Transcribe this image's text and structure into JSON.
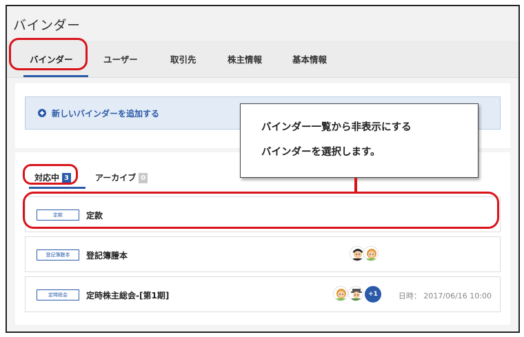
{
  "page": {
    "title": "バインダー"
  },
  "tabs": [
    {
      "label": "バインダー",
      "active": true
    },
    {
      "label": "ユーザー"
    },
    {
      "label": "取引先"
    },
    {
      "label": "株主情報"
    },
    {
      "label": "基本情報"
    }
  ],
  "add_binder": {
    "label": "新しいバインダーを追加する",
    "icon": "plus-circle-icon"
  },
  "subtabs": [
    {
      "label": "対応中",
      "count": "3",
      "active": true
    },
    {
      "label": "アーカイブ",
      "count": "0"
    }
  ],
  "binders": [
    {
      "tag": "定款",
      "title": "定款"
    },
    {
      "tag": "登記簿謄本",
      "title": "登記簿謄本",
      "avatars": [
        "user-avatar",
        "user-avatar"
      ]
    },
    {
      "tag": "定時総会",
      "title": "定時株主総会-[第1期]",
      "avatars": [
        "user-avatar",
        "user-avatar"
      ],
      "more": "+1",
      "datetime": "日時： 2017/06/16 10:00"
    }
  ],
  "callout": {
    "line1": "バインダー一覧から非表示にする",
    "line2": "バインダーを選択します。"
  },
  "colors": {
    "accent": "#2b5aa8",
    "highlight": "#d8131a"
  }
}
